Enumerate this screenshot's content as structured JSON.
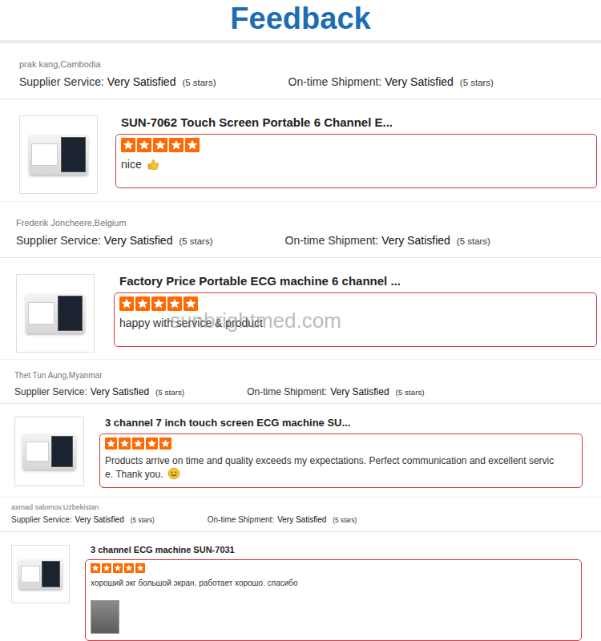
{
  "title": "Feedback",
  "watermark": "sunbrightmed.com",
  "reviews": [
    {
      "reviewer": "prak kang,Cambodia",
      "ratings": [
        {
          "label": "Supplier Service:",
          "value": "Very Satisfied",
          "stars_text": "(5 stars)"
        },
        {
          "label": "On-time Shipment:",
          "value": "Very Satisfied",
          "stars_text": "(5 stars)"
        }
      ],
      "product": "SUN-7062 Touch Screen Portable 6 Channel E...",
      "stars": 5,
      "comment": "nice",
      "comment_icon": {
        "kind": "thumbs-up"
      },
      "has_photo": false
    },
    {
      "reviewer": "Frederik Joncheere,Belgium",
      "ratings": [
        {
          "label": "Supplier Service:",
          "value": "Very Satisfied",
          "stars_text": "(5 stars)"
        },
        {
          "label": "On-time Shipment:",
          "value": "Very Satisfied",
          "stars_text": "(5 stars)"
        }
      ],
      "product": "Factory Price Portable ECG machine 6 channel ...",
      "stars": 5,
      "comment": "happy with service & product",
      "comment_icon": {
        "kind": "none"
      },
      "has_photo": false
    },
    {
      "reviewer": "Thet Tun Aung,Myanmar",
      "ratings": [
        {
          "label": "Supplier Service:",
          "value": "Very Satisfied",
          "stars_text": "(5 stars)"
        },
        {
          "label": "On-time Shipment:",
          "value": "Very Satisfied",
          "stars_text": "(5 stars)"
        }
      ],
      "product": "3 channel 7 inch touch screen ECG machine SU...",
      "stars": 5,
      "comment": "Products arrive on time and quality exceeds my expectations. Perfect communication and excellent service. Thank you.",
      "comment_icon": {
        "kind": "smiley"
      },
      "has_photo": false
    },
    {
      "reviewer": "axmad salomov,Uzbekistan",
      "ratings": [
        {
          "label": "Supplier Service:",
          "value": "Very Satisfied",
          "stars_text": "(5 stars)"
        },
        {
          "label": "On-time Shipment:",
          "value": "Very Satisfied",
          "stars_text": "(5 stars)"
        }
      ],
      "product": "3 channel ECG machine SUN-7031",
      "stars": 5,
      "comment": "хороший экг большой экран. работает хорошо. спасибо",
      "comment_icon": {
        "kind": "none"
      },
      "has_photo": true
    }
  ]
}
